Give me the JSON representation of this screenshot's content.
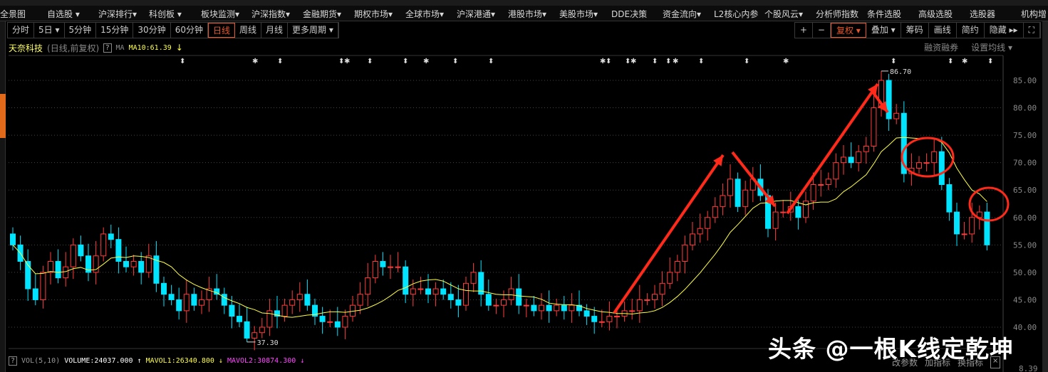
{
  "menu": [
    "全景图",
    "自选股 ▾",
    "沪深排行▾",
    "科创板 ▾",
    "板块监测▾",
    "沪深指数▾",
    "金融期货▾",
    "期权市场▾",
    "全球市场▾",
    "沪深港通▾",
    "港股市场▾",
    "美股市场▾",
    "DDE决策",
    "资金流向▾",
    "L2核心内参",
    "个股风云▾",
    "分析师指数",
    "条件选股",
    "高级选股",
    "选股器",
    "机构增"
  ],
  "periods": [
    "分时",
    "5日 ▾",
    "5分钟",
    "15分钟",
    "30分钟",
    "60分钟",
    "日线",
    "周线",
    "月线",
    "更多周期 ▾"
  ],
  "active_period": "日线",
  "tools": [
    "+",
    "−",
    "复权 ▾",
    "叠加 ▾",
    "筹码",
    "画线",
    "简约",
    "隐藏 ▸▸",
    "⛶"
  ],
  "info": {
    "stock": "天奈科技",
    "mode": "(日线,前复权)",
    "q": "?",
    "ma": "MA",
    "ma10": "MA10:61.39",
    "arrow": "↓"
  },
  "right_links": [
    "融资融券",
    "设置均线 ▾"
  ],
  "vol": {
    "q": "?",
    "name": "VOL(5,10)",
    "volume": "VOLUME:24037.000",
    "up": "↑",
    "mavol1": "MAVOL1:26340.800",
    "d1": "↓",
    "mavol2": "MAVOL2:30874.300",
    "d2": "↓"
  },
  "ind_tools": [
    "改参数",
    "加指标",
    "换指标",
    "×"
  ],
  "watermark": "头条 @一根K线定乾坤",
  "vol_axis_label": "8.39",
  "chart_data": {
    "type": "candlestick",
    "y_ticks": [
      "85.00",
      "80.00",
      "75.00",
      "70.00",
      "65.00",
      "60.00",
      "55.00",
      "50.00",
      "45.00",
      "40.00"
    ],
    "ylim": [
      40,
      85
    ],
    "first_open": 57,
    "close": [
      55,
      52,
      47,
      45,
      50,
      52,
      49,
      51,
      55,
      53,
      50,
      53,
      57,
      56,
      52,
      51,
      52,
      50,
      53,
      48,
      46,
      45,
      43,
      46,
      44,
      45,
      47,
      46,
      44,
      42,
      41,
      38,
      39,
      40,
      43,
      42,
      44,
      45,
      46,
      44,
      42,
      41,
      41,
      40,
      42,
      44,
      46,
      49,
      52,
      51,
      51,
      51,
      46,
      47,
      47,
      46,
      47,
      46,
      45,
      44,
      48,
      50,
      46,
      44,
      44,
      45,
      47,
      44,
      44,
      43,
      44,
      43,
      44,
      43,
      44,
      43,
      42,
      41,
      41,
      42,
      42,
      43,
      43,
      45,
      45,
      46,
      48,
      50,
      52,
      55,
      57,
      58,
      60,
      62,
      64,
      67,
      62,
      65,
      67,
      64,
      58,
      61,
      61,
      62,
      60,
      63,
      66,
      66,
      67,
      70,
      71,
      70,
      72,
      73,
      80,
      85,
      78,
      79,
      68,
      69,
      70,
      70,
      72,
      66,
      61,
      57,
      57,
      60,
      61,
      55
    ],
    "high_label": "86.70",
    "low_label": "37.30",
    "up_color": "#ff3c3c",
    "down_color": "#00e4ff",
    "ma_color": "#ffff44"
  }
}
